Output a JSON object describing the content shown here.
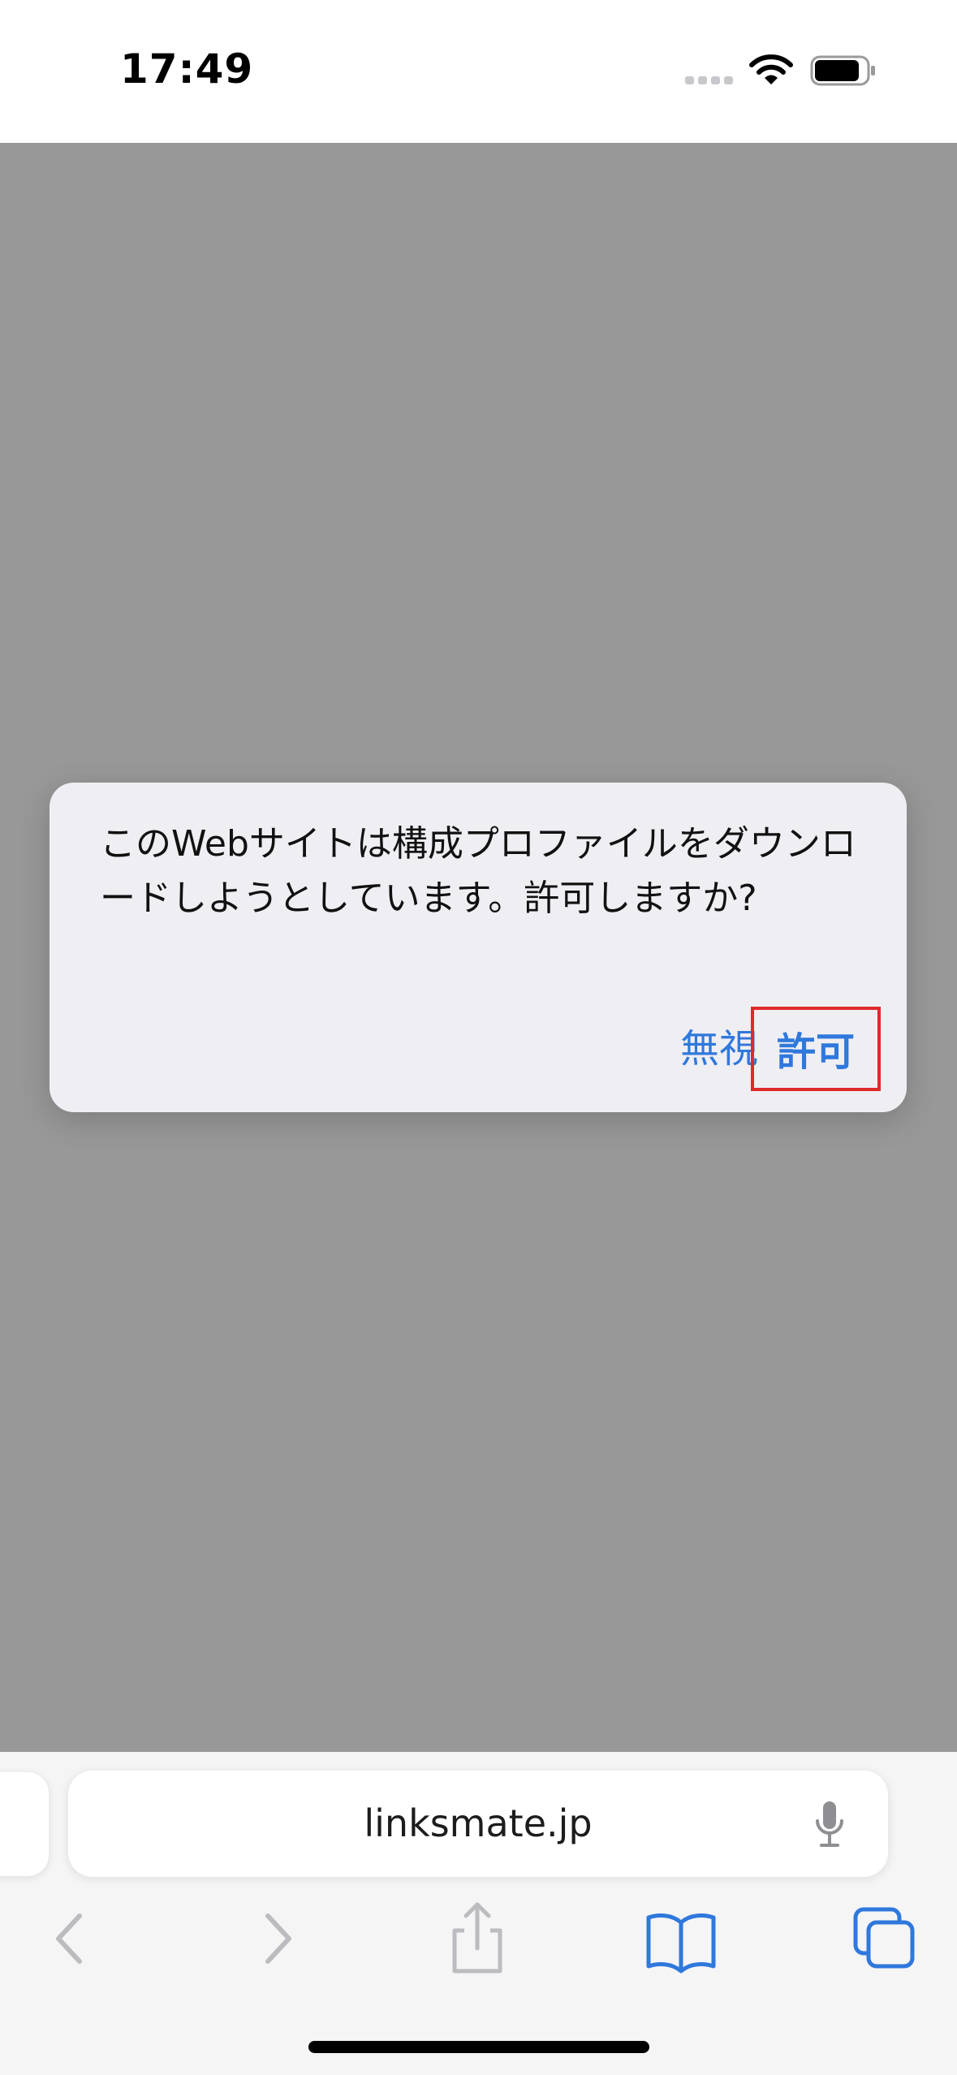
{
  "status_bar": {
    "time": "17:49"
  },
  "alert": {
    "message": "このWebサイトは構成プロファイルをダウンロードしようとしています。許可しますか?",
    "ignore_label": "無視",
    "allow_label": "許可"
  },
  "address_bar": {
    "url": "linksmate.jp"
  },
  "toolbar": {
    "icons": [
      "back-icon",
      "forward-icon",
      "share-icon",
      "bookmarks-icon",
      "tabs-icon"
    ]
  },
  "colors": {
    "accent": "#2f78dc",
    "overlay": "#989898",
    "alert_bg": "#efeef3",
    "highlight_border": "#e02a2a"
  }
}
